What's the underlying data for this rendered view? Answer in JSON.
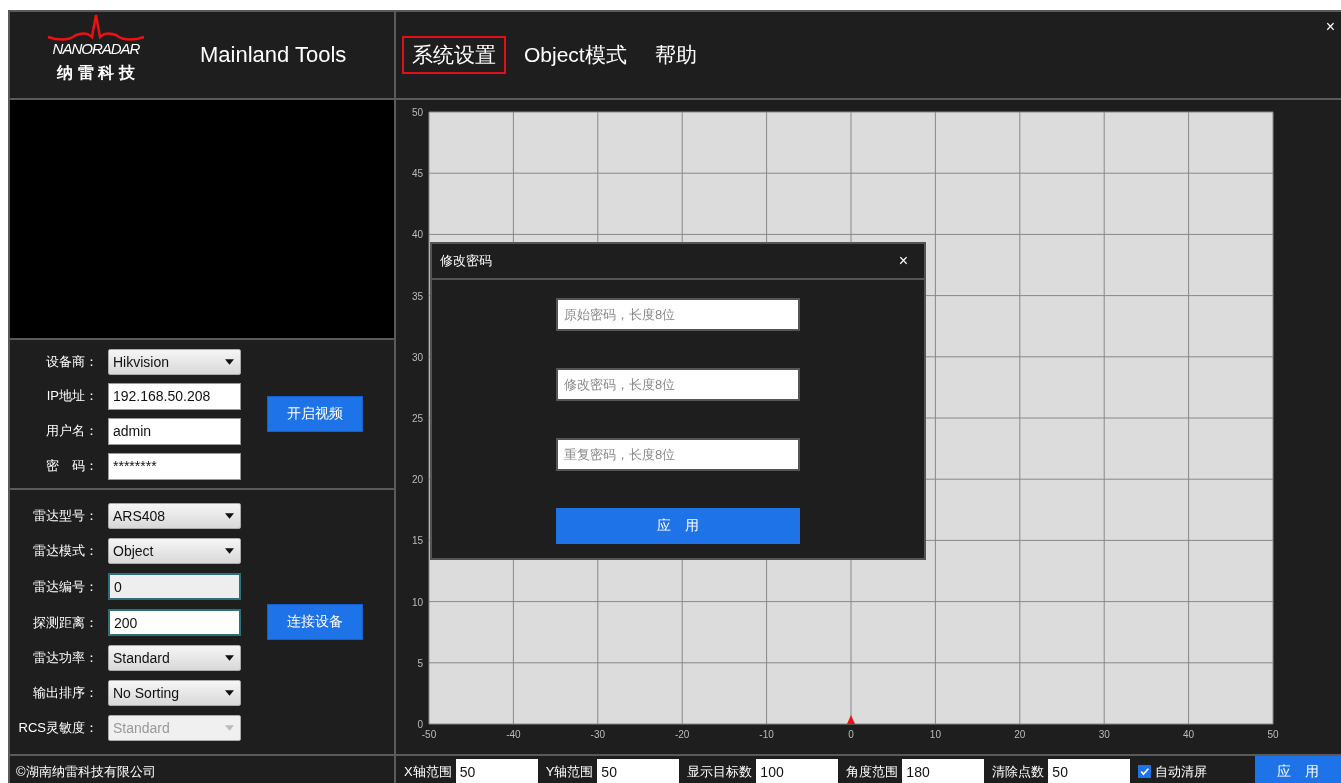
{
  "header": {
    "logo_text": "NANORADAR",
    "logo_subtitle": "纳 雷 科 技",
    "app_title": "Mainland Tools"
  },
  "menu": [
    {
      "label": "系统设置",
      "selected": true
    },
    {
      "label": "Object模式",
      "selected": false
    },
    {
      "label": "帮助",
      "selected": false
    }
  ],
  "close_button": "×",
  "camera_form": {
    "fields": [
      {
        "label": "设备商：",
        "kind": "select",
        "value": "Hikvision",
        "disabled": false
      },
      {
        "label": "IP地址：",
        "kind": "input",
        "value": "192.168.50.208",
        "disabled": false
      },
      {
        "label": "用户名：",
        "kind": "input",
        "value": "admin",
        "disabled": false
      },
      {
        "label": "密　码：",
        "kind": "input",
        "value": "********",
        "disabled": false
      }
    ],
    "button": "开启视频"
  },
  "radar_form": {
    "fields": [
      {
        "label": "雷达型号：",
        "kind": "select",
        "value": "ARS408",
        "disabled": false
      },
      {
        "label": "雷达模式：",
        "kind": "select",
        "value": "Object",
        "disabled": false
      },
      {
        "label": "雷达编号：",
        "kind": "input",
        "value": "0",
        "disabled": true
      },
      {
        "label": "探测距离：",
        "kind": "input",
        "value": "200",
        "disabled": false
      },
      {
        "label": "雷达功率：",
        "kind": "select",
        "value": "Standard",
        "disabled": false
      },
      {
        "label": "输出排序：",
        "kind": "select",
        "value": "No Sorting",
        "disabled": false
      },
      {
        "label": "RCS灵敏度：",
        "kind": "select",
        "value": "Standard",
        "disabled": true
      }
    ],
    "button": "连接设备"
  },
  "copyright": "©湖南纳雷科技有限公司",
  "chart": {
    "chart_data": {
      "type": "scatter",
      "grid": true,
      "xlim": [
        -50,
        50
      ],
      "ylim": [
        0,
        50
      ],
      "xticks": [
        -50,
        -40,
        -30,
        -20,
        -10,
        0,
        10,
        20,
        30,
        40,
        50
      ],
      "yticks": [
        0,
        5,
        10,
        15,
        20,
        25,
        30,
        35,
        40,
        45,
        50
      ]
    }
  },
  "dialog": {
    "title": "修改密码",
    "close": "×",
    "fields": [
      {
        "placeholder": "原始密码，长度8位"
      },
      {
        "placeholder": "修改密码，长度8位"
      },
      {
        "placeholder": "重复密码，长度8位"
      }
    ],
    "button": "应　用"
  },
  "bottom_bar": {
    "fields": [
      {
        "label": "X轴范围",
        "value": "50"
      },
      {
        "label": "Y轴范围",
        "value": "50"
      },
      {
        "label": "显示目标数",
        "value": "100"
      },
      {
        "label": "角度范围",
        "value": "180"
      },
      {
        "label": "清除点数",
        "value": "50"
      }
    ],
    "auto_clear": {
      "label": "自动清屏",
      "checked": true
    },
    "button": "应　用"
  }
}
